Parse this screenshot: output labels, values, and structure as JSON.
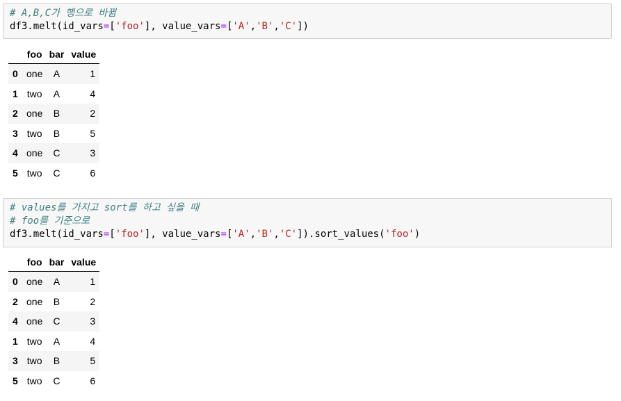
{
  "cell1": {
    "code_lines": [
      [
        {
          "t": "cm",
          "v": "# A,B,C가 행으로 바뀜"
        }
      ],
      [
        {
          "t": "plain",
          "v": "df3.melt(id_vars"
        },
        {
          "t": "op",
          "v": "="
        },
        {
          "t": "plain",
          "v": "["
        },
        {
          "t": "str",
          "v": "'foo'"
        },
        {
          "t": "plain",
          "v": "], value_vars"
        },
        {
          "t": "op",
          "v": "="
        },
        {
          "t": "plain",
          "v": "["
        },
        {
          "t": "str",
          "v": "'A'"
        },
        {
          "t": "plain",
          "v": ","
        },
        {
          "t": "str",
          "v": "'B'"
        },
        {
          "t": "plain",
          "v": ","
        },
        {
          "t": "str",
          "v": "'C'"
        },
        {
          "t": "plain",
          "v": "])"
        }
      ]
    ],
    "table": {
      "headers": [
        "",
        "foo",
        "bar",
        "value"
      ],
      "rows": [
        {
          "index": "0",
          "foo": "one",
          "bar": "A",
          "value": "1"
        },
        {
          "index": "1",
          "foo": "two",
          "bar": "A",
          "value": "4"
        },
        {
          "index": "2",
          "foo": "one",
          "bar": "B",
          "value": "2"
        },
        {
          "index": "3",
          "foo": "two",
          "bar": "B",
          "value": "5"
        },
        {
          "index": "4",
          "foo": "one",
          "bar": "C",
          "value": "3"
        },
        {
          "index": "5",
          "foo": "two",
          "bar": "C",
          "value": "6"
        }
      ]
    }
  },
  "cell2": {
    "code_lines": [
      [
        {
          "t": "cm",
          "v": "# values를 가지고 sort를 하고 싶을 때"
        }
      ],
      [
        {
          "t": "cm",
          "v": "# foo를 기준으로"
        }
      ],
      [
        {
          "t": "plain",
          "v": "df3.melt(id_vars"
        },
        {
          "t": "op",
          "v": "="
        },
        {
          "t": "plain",
          "v": "["
        },
        {
          "t": "str",
          "v": "'foo'"
        },
        {
          "t": "plain",
          "v": "], value_vars"
        },
        {
          "t": "op",
          "v": "="
        },
        {
          "t": "plain",
          "v": "["
        },
        {
          "t": "str",
          "v": "'A'"
        },
        {
          "t": "plain",
          "v": ","
        },
        {
          "t": "str",
          "v": "'B'"
        },
        {
          "t": "plain",
          "v": ","
        },
        {
          "t": "str",
          "v": "'C'"
        },
        {
          "t": "plain",
          "v": "]).sort_values("
        },
        {
          "t": "str",
          "v": "'foo'"
        },
        {
          "t": "plain",
          "v": ")"
        }
      ]
    ],
    "table": {
      "headers": [
        "",
        "foo",
        "bar",
        "value"
      ],
      "rows": [
        {
          "index": "0",
          "foo": "one",
          "bar": "A",
          "value": "1"
        },
        {
          "index": "2",
          "foo": "one",
          "bar": "B",
          "value": "2"
        },
        {
          "index": "4",
          "foo": "one",
          "bar": "C",
          "value": "3"
        },
        {
          "index": "1",
          "foo": "two",
          "bar": "A",
          "value": "4"
        },
        {
          "index": "3",
          "foo": "two",
          "bar": "B",
          "value": "5"
        },
        {
          "index": "5",
          "foo": "two",
          "bar": "C",
          "value": "6"
        }
      ]
    }
  },
  "colors": {
    "comment": "#408080",
    "string": "#ba2121",
    "operator": "#aa22ff",
    "cell_background": "#f7f7f7",
    "cell_border": "#cfcfcf",
    "row_stripe": "#f5f5f5"
  }
}
